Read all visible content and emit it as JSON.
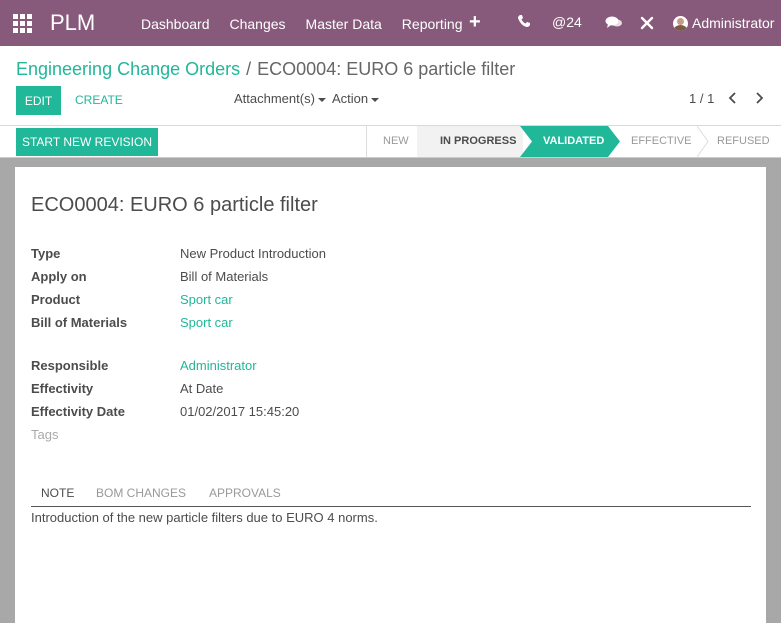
{
  "navbar": {
    "app_name": "PLM",
    "menu": [
      "Dashboard",
      "Changes",
      "Master Data",
      "Reporting"
    ],
    "plus_icon": "plus-icon",
    "mention_count": "@24",
    "user_name": "Administrator",
    "background_color": "#875a7b"
  },
  "breadcrumb": {
    "parent": "Engineering Change Orders",
    "separator": "/",
    "current": "ECO0004: EURO 6 particle filter"
  },
  "toolbar": {
    "edit_label": "EDIT",
    "create_label": "CREATE",
    "attachments_label": "Attachment(s)",
    "action_label": "Action",
    "pager": "1 / 1"
  },
  "statusbar": {
    "revision_button": "START NEW REVISION",
    "stages": [
      "NEW",
      "IN PROGRESS",
      "VALIDATED",
      "EFFECTIVE",
      "REFUSED"
    ],
    "active_stage": "VALIDATED",
    "accent_color": "#21b799"
  },
  "form": {
    "title": "ECO0004: EURO 6 particle filter",
    "fields": [
      {
        "label": "Type",
        "value": "New Product Introduction"
      },
      {
        "label": "Apply on",
        "value": "Bill of Materials"
      },
      {
        "label": "Product",
        "value": "Sport car"
      },
      {
        "label": "Bill of Materials",
        "value": "Sport car"
      },
      {
        "label": "Responsible",
        "value": "Administrator"
      },
      {
        "label": "Effectivity",
        "value": "At Date"
      },
      {
        "label": "Effectivity Date",
        "value": "01/02/2017 15:45:20"
      },
      {
        "label": "Tags",
        "value": ""
      }
    ],
    "tabs": [
      "NOTE",
      "BOM CHANGES",
      "APPROVALS"
    ],
    "active_tab": "NOTE",
    "note": "Introduction of the new particle filters due to EURO 4 norms."
  }
}
